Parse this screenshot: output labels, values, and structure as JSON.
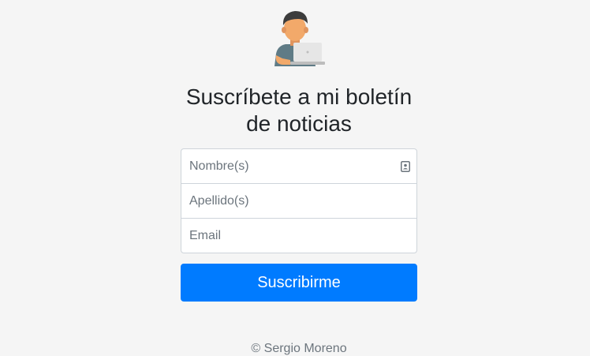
{
  "header": {
    "avatar_icon": "person-with-laptop-icon",
    "title_line1": "Suscríbete a mi boletín",
    "title_line2": "de noticias"
  },
  "form": {
    "first_name": {
      "placeholder": "Nombre(s)",
      "value": "",
      "icon": "contact-card-icon"
    },
    "last_name": {
      "placeholder": "Apellido(s)",
      "value": ""
    },
    "email": {
      "placeholder": "Email",
      "value": ""
    },
    "submit_label": "Suscribirme"
  },
  "footer": {
    "copyright": "© Sergio Moreno"
  },
  "colors": {
    "background": "#f5f5f5",
    "primary": "#007bff",
    "input_border": "#ced4da",
    "placeholder": "#6c757d"
  }
}
